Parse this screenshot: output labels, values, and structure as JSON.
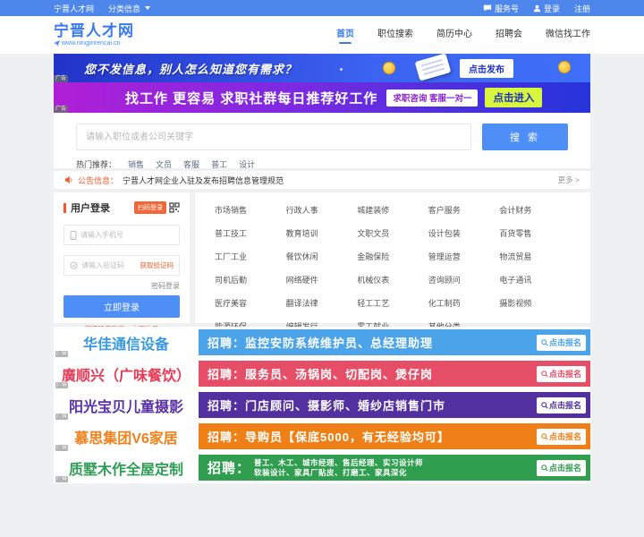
{
  "topbar": {
    "site": "宁晋人才网",
    "classified": "分类信息",
    "service": "服务号",
    "login": "登录",
    "register": "注册"
  },
  "header": {
    "logo_title": "宁晋人才网",
    "logo_url": "www.ningjinrencai.cn",
    "nav": [
      {
        "label": "首页"
      },
      {
        "label": "职位搜索"
      },
      {
        "label": "简历中心"
      },
      {
        "label": "招聘会"
      },
      {
        "label": "微信找工作"
      }
    ]
  },
  "banner_publish": {
    "text": "您不发信息，别人怎么知道您有需求？",
    "button": "点击发布",
    "ad_tag": "广告"
  },
  "banner_group": {
    "text": "找工作 更容易 求职社群每日推荐好工作",
    "badge": "求职咨询 客服一对一",
    "button": "点击进入",
    "ad_tag": "广告"
  },
  "search": {
    "placeholder": "请输入职位或者公司关键字",
    "button": "搜 索",
    "hot_label": "热门推荐：",
    "hot_links": [
      "销售",
      "文员",
      "客服",
      "普工",
      "设计"
    ]
  },
  "announcement": {
    "label": "公告信息：",
    "text": "宁晋人才网企业入驻及发布招聘信息管理规范",
    "more": "更多 >"
  },
  "login_panel": {
    "title": "用户登录",
    "scan_badge": "扫码登录",
    "phone_placeholder": "请输入手机号",
    "captcha_placeholder": "请输入验证码",
    "get_code": "获取验证码",
    "pwd_login": "密码登录",
    "login_button": "立即登录",
    "register_hint": "我还没有账号，立即注册",
    "accent_color": "#f05a28",
    "button_color": "#4e8ef7"
  },
  "categories": {
    "items": [
      "市场销售",
      "行政人事",
      "城建装修",
      "客户服务",
      "会计财务",
      "普工技工",
      "教育培训",
      "文职文员",
      "设计包装",
      "百货零售",
      "工厂工业",
      "餐饮休闲",
      "金融保险",
      "管理运营",
      "物流贸易",
      "司机后勤",
      "网络硬件",
      "机械仪表",
      "咨询顾问",
      "电子通讯",
      "医疗美容",
      "翻译法律",
      "轻工工艺",
      "化工制药",
      "摄影视频",
      "能源环保",
      "编辑发行",
      "零工就业",
      "其他分类"
    ]
  },
  "companies": [
    {
      "name": "华佳通信设备",
      "text": "招聘：监控安防系统维护员、总经理助理",
      "button": "点击报名",
      "name_color": "#3898e0",
      "banner_color": "#4ba4ea",
      "ad_tag": "广告"
    },
    {
      "name": "廣顺兴（广味餐饮）",
      "text": "招聘：服务员、汤锅岗、切配岗、煲仔岗",
      "button": "点击报名",
      "name_color": "#e83a55",
      "banner_color": "#e64e68",
      "ad_tag": "广告"
    },
    {
      "name": "阳光宝贝儿童摄影",
      "text": "招聘：门店顾问、摄影师、婚纱店销售门市",
      "button": "点击报名",
      "name_color": "#5b32a8",
      "banner_color": "#52309f",
      "ad_tag": "广告"
    },
    {
      "name": "慕思集团V6家居",
      "text": "招聘：导购员【保底5000，有无经验均可】",
      "button": "点击报名",
      "name_color": "#f08018",
      "banner_color": "#ef8018",
      "ad_tag": "广告"
    },
    {
      "name": "质墅木作全屋定制",
      "prefix": "招聘：",
      "line1": "普工、木工、城市经理、售后经理、实习设计师",
      "line2": "软装设计、家具厂贴皮、打磨工、家具深化",
      "button": "点击报名",
      "name_color": "#2f9e55",
      "banner_color": "#2f9e4f",
      "ad_tag": "广告"
    }
  ]
}
